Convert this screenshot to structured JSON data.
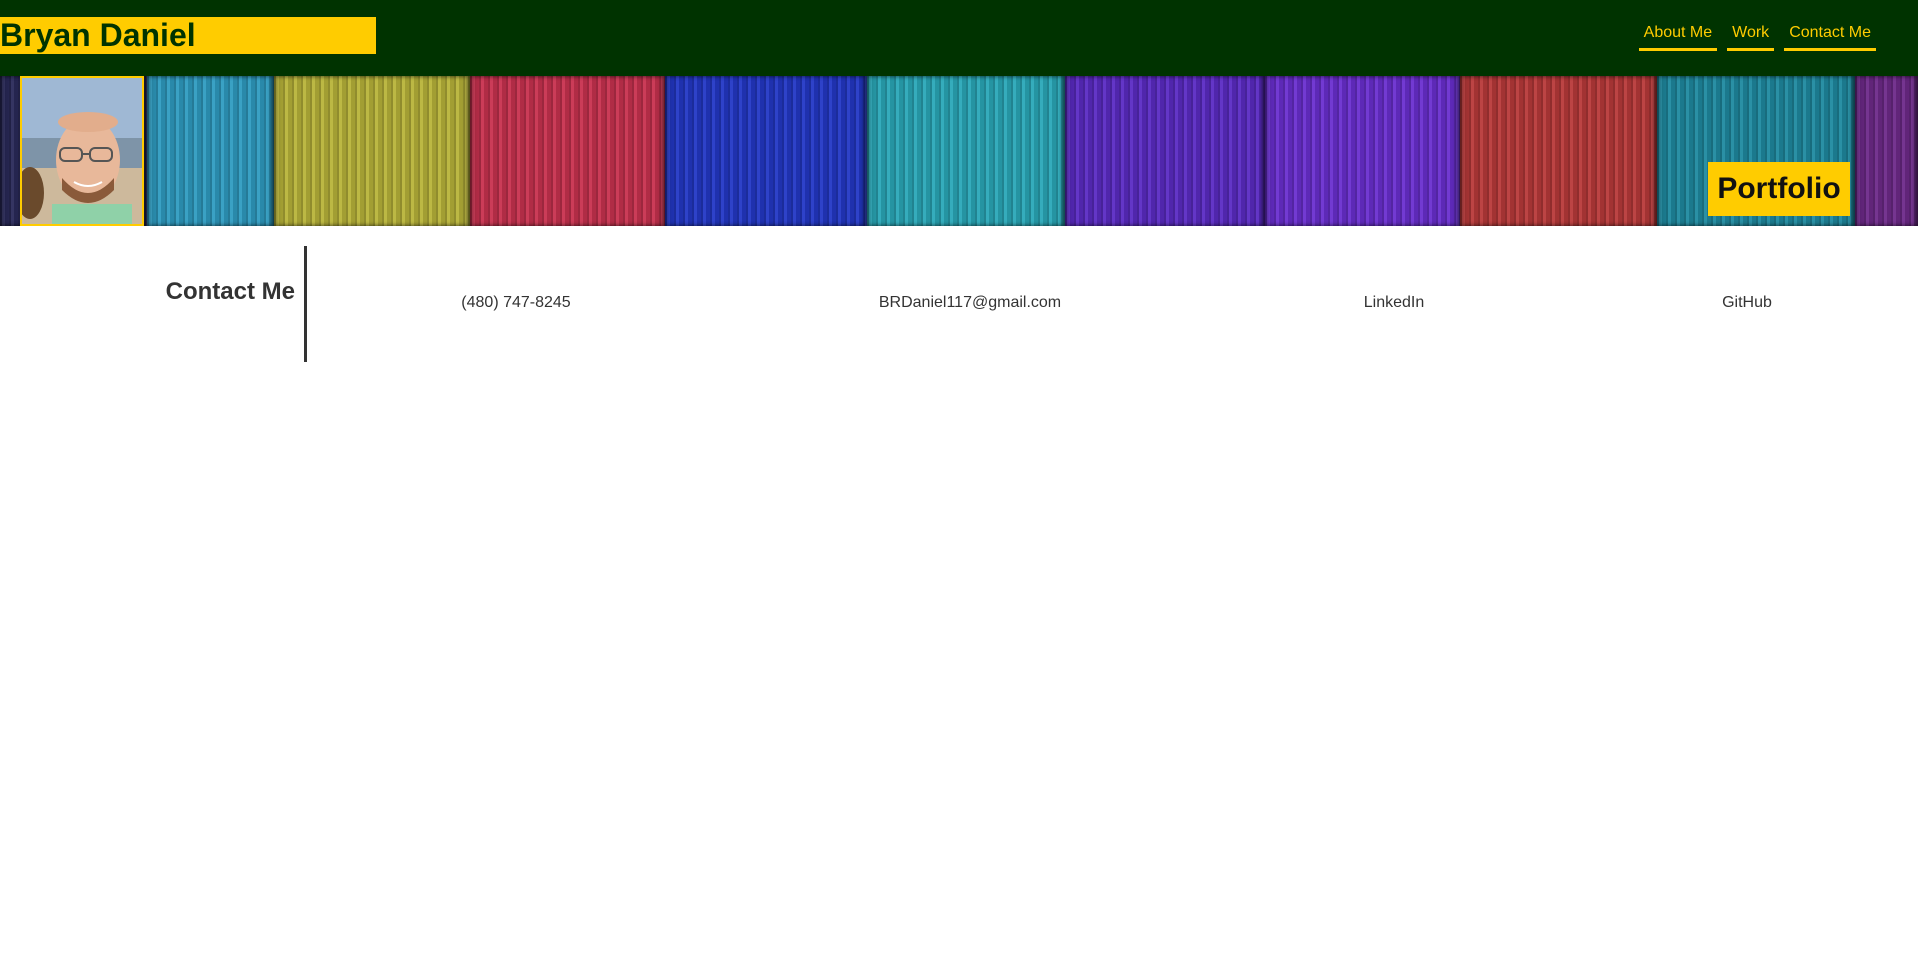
{
  "header": {
    "site_name": "Bryan Daniel",
    "nav": [
      {
        "label": "About Me"
      },
      {
        "label": "Work"
      },
      {
        "label": "Contact Me"
      }
    ]
  },
  "banner": {
    "badge": "Portfolio",
    "plank_colors": [
      "#2a2a5a",
      "#2f9cc1",
      "#b8b43a",
      "#c8324f",
      "#2338c6",
      "#2aa8b8",
      "#5b2bc4",
      "#6a2fd0",
      "#b83a3a",
      "#1f8aa0",
      "#6e2a8a"
    ]
  },
  "contact": {
    "heading": "Contact Me",
    "items": [
      {
        "label": "(480) 747-8245"
      },
      {
        "label": "BRDaniel117@gmail.com"
      },
      {
        "label": "LinkedIn"
      },
      {
        "label": "GitHub"
      }
    ]
  },
  "colors": {
    "header_bg": "#003300",
    "accent": "#ffcc00",
    "text": "#333333"
  }
}
